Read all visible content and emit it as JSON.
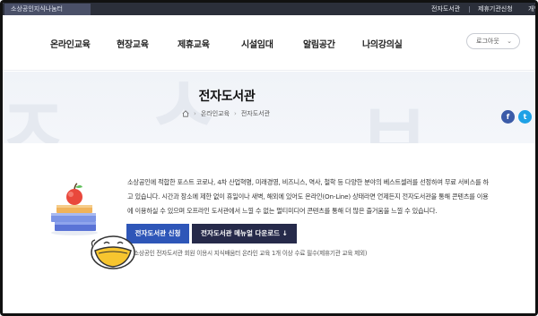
{
  "topbar": {
    "org_name": "소상공인지식나눔터",
    "links": [
      "전자도서관",
      "제휴기관신청",
      "개인"
    ]
  },
  "gnb": {
    "menu": [
      "온라인교육",
      "현장교육",
      "제휴교육",
      "시설임대",
      "알림공간",
      "나의강의실"
    ],
    "logout_label": "로그아웃"
  },
  "page": {
    "title": "전자도서관",
    "breadcrumb": [
      "온라인교육",
      "전자도서관"
    ]
  },
  "content": {
    "description": [
      "소상공인에 적합한 포스트 코로나, 4차 산업혁명, 미래경영, 비즈니스, 역사, 철학 등 다양한 분야의 베스트셀러를 선정하여 무료 서비스를 하",
      "고 있습니다. 시간과 장소에 제한 없이 휴일이나 새벽, 해외에 있어도 온라인(On-Line) 상태라면 언제든지 전자도서관을 통해 콘텐츠를 이용",
      "에 이용하실 수 있으며 오프라인 도서관에서 느낄 수 없는 멀티미디어 콘텐츠를 통해 더 많은 즐거움을 느낄 수 있습니다."
    ],
    "apply_button": "전자도서관 신청",
    "manual_button": "전자도서관 메뉴얼 다운로드 ↓",
    "note": "소상공인 전자도서관 회원 이용시 지식배움터 온라인 교육 1개 이상 수료 필수(제휴기관 교육 제외)"
  },
  "sns": [
    "f",
    "t"
  ],
  "colors": {
    "topbar": "#2b2f3a",
    "apply": "#2e56b8",
    "manual": "#262a4a",
    "facebook": "#3b5ba8",
    "twitter": "#1ea1e6"
  }
}
